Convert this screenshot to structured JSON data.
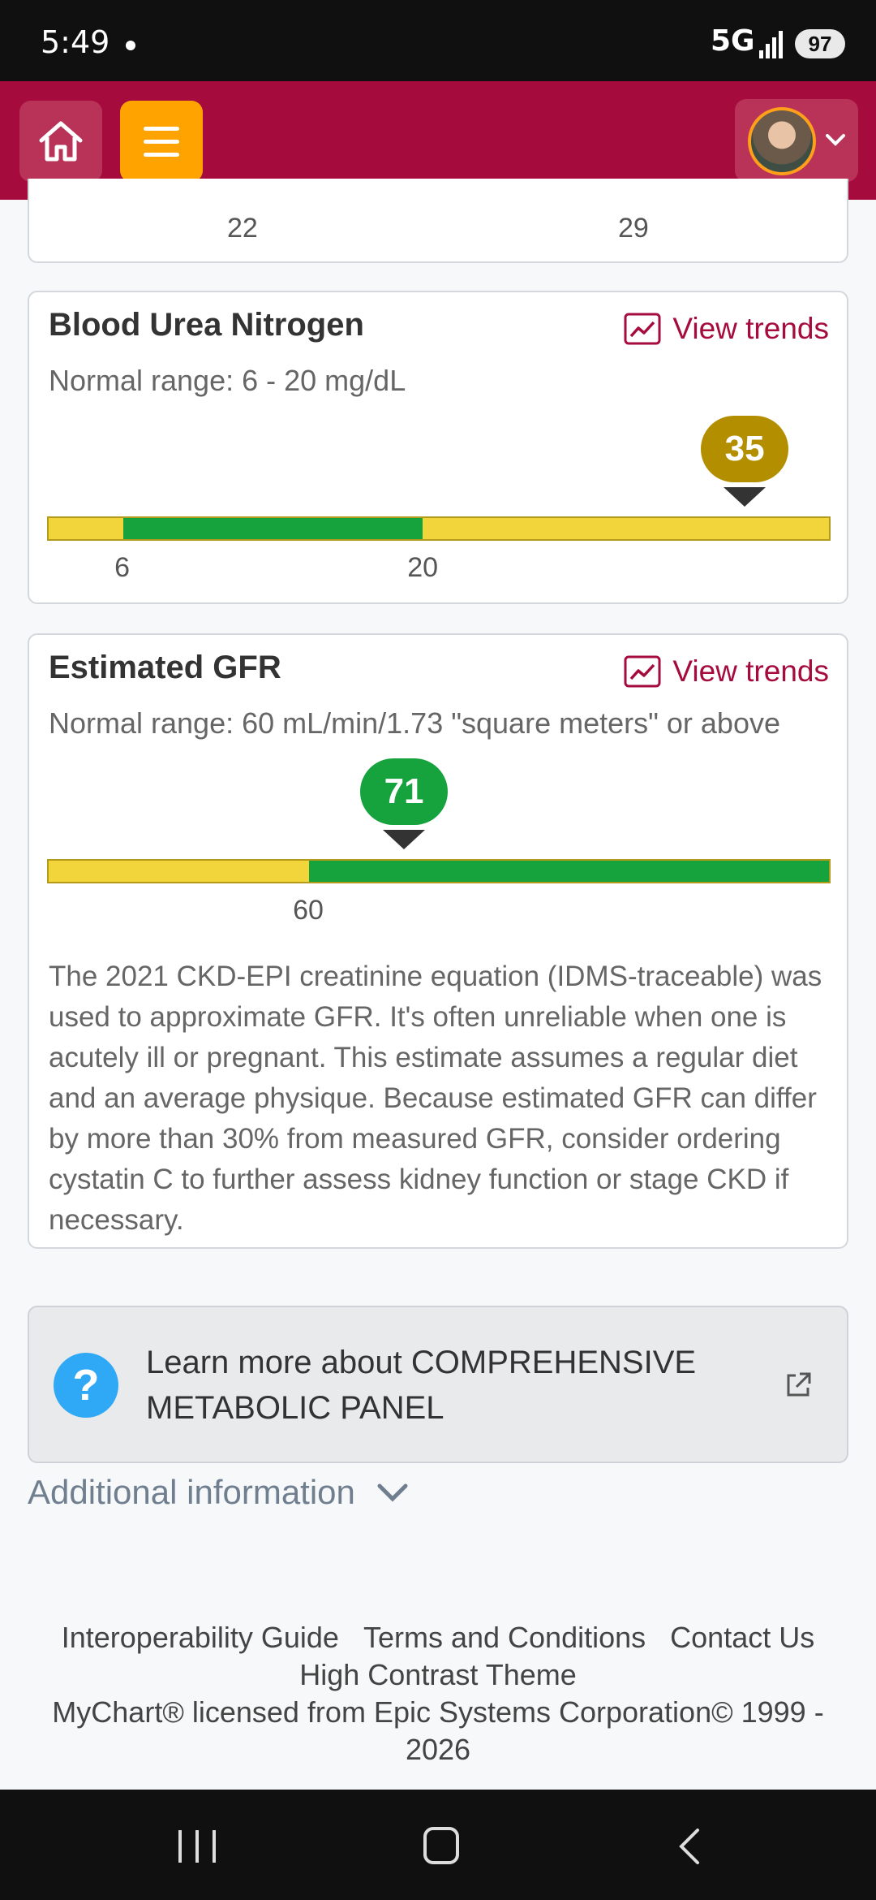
{
  "status_bar": {
    "time": "5:49",
    "network": "5G",
    "battery": "97"
  },
  "header": {
    "home_icon": "home-icon",
    "menu_icon": "hamburger-menu-icon",
    "profile_caret_icon": "chevron-down-icon",
    "colors": {
      "header_bg": "#a50b3c",
      "menu_bg": "#ffa300"
    }
  },
  "previous_card": {
    "tick_labels": [
      "22",
      "29"
    ]
  },
  "bun": {
    "title": "Blood Urea Nitrogen",
    "trends_label": "View trends",
    "normal_range": "Normal range: 6 - 20 mg/dL",
    "value": "35",
    "value_num": 35,
    "scale_min": 2.5,
    "scale_max": 39.0,
    "low_limit": 6,
    "high_limit": 20,
    "tick_labels": [
      "6",
      "20"
    ],
    "marker_color": "#b38f00"
  },
  "gfr": {
    "title": "Estimated GFR",
    "trends_label": "View trends",
    "normal_range": "Normal range: 60 mL/min/1.73 \"square meters\" or above",
    "value": "71",
    "value_num": 71,
    "scale_min": 30,
    "scale_max": 120,
    "low_limit": 60,
    "tick_labels": [
      "60"
    ],
    "marker_color": "#16a33e",
    "description": "The 2021 CKD-EPI creatinine equation (IDMS-traceable) was used to approximate GFR. It's often unreliable when one is acutely ill or pregnant. This estimate assumes a regular diet and an average physique. Because estimated GFR can differ by more than 30% from measured GFR, consider ordering cystatin C to further assess kidney function or stage CKD if necessary."
  },
  "learn_more": {
    "text": "Learn more about COMPREHENSIVE METABOLIC PANEL",
    "icon": "help-icon",
    "link_icon": "external-link-icon"
  },
  "additional_info": {
    "label": "Additional information"
  },
  "footer": {
    "links": [
      "Interoperability Guide",
      "Terms and Conditions",
      "Contact Us",
      "High Contrast Theme"
    ],
    "license": "MyChart® licensed from Epic Systems Corporation© 1999 - 2026"
  }
}
